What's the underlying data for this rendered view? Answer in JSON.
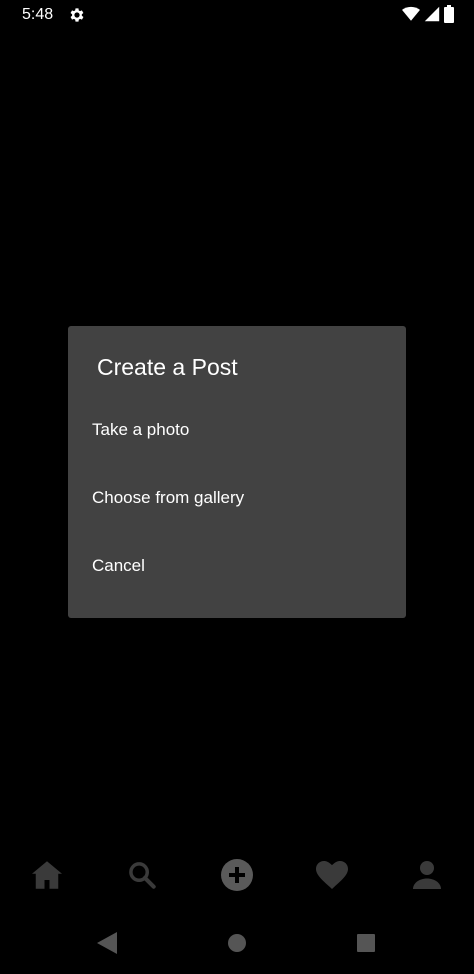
{
  "status_bar": {
    "time": "5:48"
  },
  "dialog": {
    "title": "Create a Post",
    "options": [
      {
        "label": "Take a photo"
      },
      {
        "label": "Choose from gallery"
      },
      {
        "label": "Cancel"
      }
    ]
  },
  "bottom_nav": {
    "items": [
      {
        "icon": "home-icon"
      },
      {
        "icon": "search-icon"
      },
      {
        "icon": "add-circle-icon"
      },
      {
        "icon": "heart-icon"
      },
      {
        "icon": "person-icon"
      }
    ],
    "icon_color": "#3a3a3a",
    "active_icon_color": "#5a5a5a"
  },
  "system_nav": {
    "items": [
      {
        "icon": "back-icon"
      },
      {
        "icon": "home-circle-icon"
      },
      {
        "icon": "recents-icon"
      }
    ],
    "icon_color": "#555555"
  },
  "colors": {
    "background": "#000000",
    "dialog_background": "#424242",
    "text": "#ffffff"
  }
}
